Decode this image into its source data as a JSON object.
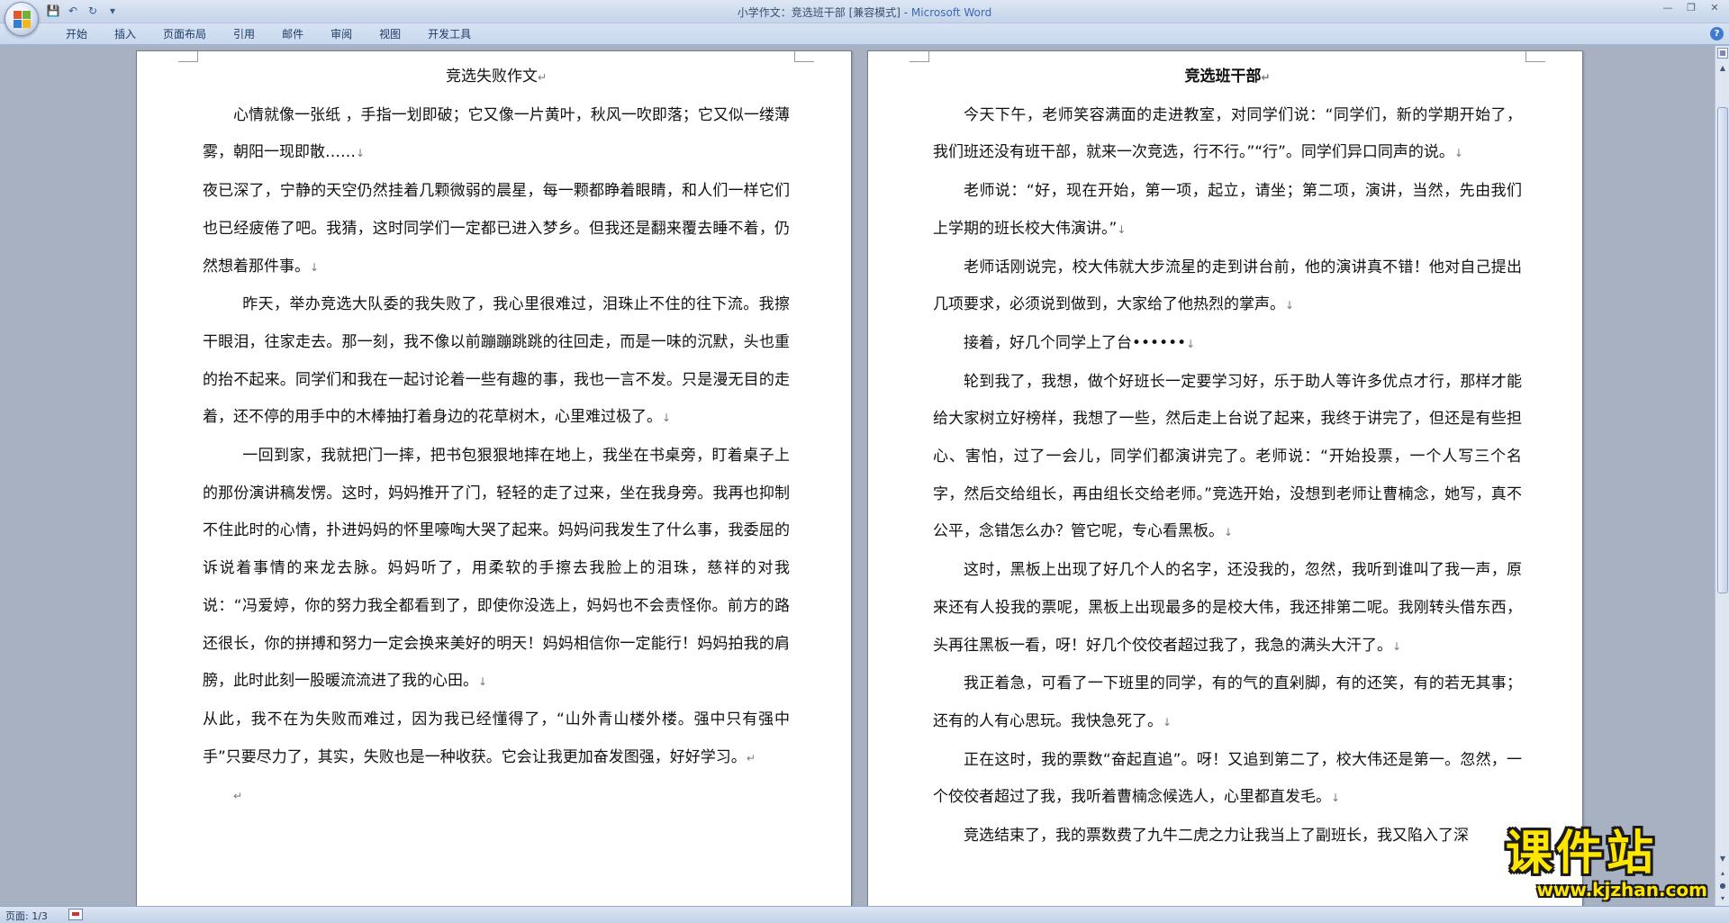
{
  "window": {
    "title_doc": "小学作文：竞选班干部 [兼容模式] - ",
    "title_app": "Microsoft Word"
  },
  "qat": {
    "save": "💾",
    "undo": "↶",
    "redo": "↻",
    "more": "▾"
  },
  "ribbon": {
    "tabs": [
      "开始",
      "插入",
      "页面布局",
      "引用",
      "邮件",
      "审阅",
      "视图",
      "开发工具"
    ]
  },
  "left_page": {
    "title": "竞选失败作文",
    "paragraphs": [
      {
        "style": "ind",
        "text": "心情就像一张纸 ，手指一划即破；它又像一片黄叶，秋风一吹即落；它又似一缕薄雾，朝阳一现即散……",
        "mark": "↓"
      },
      {
        "style": "noind",
        "text": "夜已深了，宁静的天空仍然挂着几颗微弱的晨星，每一颗都睁着眼睛，和人们一样它们也已经疲倦了吧。我猜，这时同学们一定都已进入梦乡。但我还是翻来覆去睡不着，仍然想着那件事。",
        "mark": "↓"
      },
      {
        "style": "ind15",
        "text": "昨天，举办竞选大队委的我失败了，我心里很难过，泪珠止不住的往下流。我擦干眼泪，往家走去。那一刻，我不像以前蹦蹦跳跳的往回走，而是一味的沉默，头也重的抬不起来。同学们和我在一起讨论着一些有趣的事，我也一言不发。只是漫无目的走着，还不停的用手中的木棒抽打着身边的花草树木，心里难过极了。",
        "mark": "↓"
      },
      {
        "style": "ind15",
        "text": "一回到家，我就把门一摔，把书包狠狠地摔在地上，我坐在书桌旁，盯着桌子上的那份演讲稿发愣。这时，妈妈推开了门，轻轻的走了过来，坐在我身旁。我再也抑制不住此时的心情，扑进妈妈的怀里嚎啕大哭了起来。妈妈问我发生了什么事，我委屈的诉说着事情的来龙去脉。妈妈听了，用柔软的手擦去我脸上的泪珠，慈祥的对我说：“冯爱婷，你的努力我全都看到了，即使你没选上，妈妈也不会责怪你。前方的路还很长，你的拼搏和努力一定会换来美好的明天！妈妈相信你一定能行！妈妈拍我的肩膀，此时此刻一股暖流流进了我的心田。",
        "mark": "↓"
      },
      {
        "style": "noind",
        "text": "从此，我不在为失败而难过，因为我已经懂得了，“山外青山楼外楼。强中只有强中手”只要尽力了，其实，失败也是一种收获。它会让我更加奋发图强，好好学习。",
        "mark": "↵"
      },
      {
        "style": "ind",
        "text": "",
        "mark": "↵"
      }
    ]
  },
  "right_page": {
    "title": "竞选班干部",
    "paragraphs": [
      {
        "style": "ind",
        "text": "今天下午，老师笑容满面的走进教室，对同学们说：“同学们，新的学期开始了，我们班还没有班干部，就来一次竞选，行不行。”“行”。同学们异口同声的说。",
        "mark": "↓"
      },
      {
        "style": "ind",
        "text": "老师说：“好，现在开始，第一项，起立，请坐；第二项，演讲，当然，先由我们上学期的班长校大伟演讲。”",
        "mark": "↓"
      },
      {
        "style": "ind",
        "text": "老师话刚说完，校大伟就大步流星的走到讲台前，他的演讲真不错！他对自己提出几项要求，必须说到做到，大家给了他热烈的掌声。",
        "mark": "↓"
      },
      {
        "style": "ind",
        "text": "接着，好几个同学上了台••••••",
        "mark": "↓"
      },
      {
        "style": "ind",
        "text": "轮到我了，我想，做个好班长一定要学习好，乐于助人等许多优点才行，那样才能给大家树立好榜样，我想了一些，然后走上台说了起来，我终于讲完了，但还是有些担心、害怕，过了一会儿，同学们都演讲完了。老师说：“开始投票，一个人写三个名字，然后交给组长，再由组长交给老师。”竞选开始，没想到老师让曹楠念，她写，真不公平，念错怎么办？管它呢，专心看黑板。",
        "mark": "↓"
      },
      {
        "style": "ind",
        "text": "这时，黑板上出现了好几个人的名字，还没我的，忽然，我听到谁叫了我一声，原来还有人投我的票呢，黑板上出现最多的是校大伟，我还排第二呢。我刚转头借东西，头再往黑板一看，呀！好几个佼佼者超过我了，我急的满头大汗了。",
        "mark": "↓"
      },
      {
        "style": "ind",
        "text": "我正着急，可看了一下班里的同学，有的气的直剁脚，有的还笑，有的若无其事；还有的人有心思玩。我快急死了。",
        "mark": "↓"
      },
      {
        "style": "ind",
        "text": "正在这时，我的票数“奋起直追”。呀！又追到第二了，校大伟还是第一。忽然，一个佼佼者超过了我，我听着曹楠念候选人，心里都直发毛。",
        "mark": "↓"
      },
      {
        "style": "ind",
        "text": "竞选结束了，我的票数费了九牛二虎之力让我当上了副班长，我又陷入了深",
        "mark": ""
      }
    ]
  },
  "statusbar": {
    "page_info": "页面: 1/3"
  },
  "watermark": {
    "name": "课件站",
    "url": "www.kjzhan.com"
  }
}
